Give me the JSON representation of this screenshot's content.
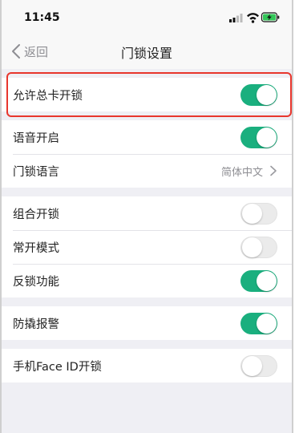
{
  "status": {
    "time": "11:45"
  },
  "nav": {
    "back_label": "返回",
    "title": "门锁设置"
  },
  "groups": [
    {
      "rows": [
        {
          "label": "允许总卡开锁",
          "toggle": true
        }
      ]
    },
    {
      "rows": [
        {
          "label": "语音开启",
          "toggle": true
        },
        {
          "label": "门锁语言",
          "value": "简体中文"
        }
      ]
    },
    {
      "rows": [
        {
          "label": "组合开锁",
          "toggle": false
        },
        {
          "label": "常开模式",
          "toggle": false
        },
        {
          "label": "反锁功能",
          "toggle": true
        }
      ]
    },
    {
      "rows": [
        {
          "label": "防撬报警",
          "toggle": true
        }
      ]
    },
    {
      "rows": [
        {
          "label": "手机Face ID开锁",
          "toggle": false
        }
      ]
    }
  ],
  "colors": {
    "accent": "#1aaf7e",
    "highlight": "#e8362d",
    "toggle_off": "#ebebeb"
  },
  "icons": [
    "signal-icon",
    "wifi-icon",
    "battery-charging-icon",
    "chevron-left-icon",
    "chevron-right-icon"
  ]
}
